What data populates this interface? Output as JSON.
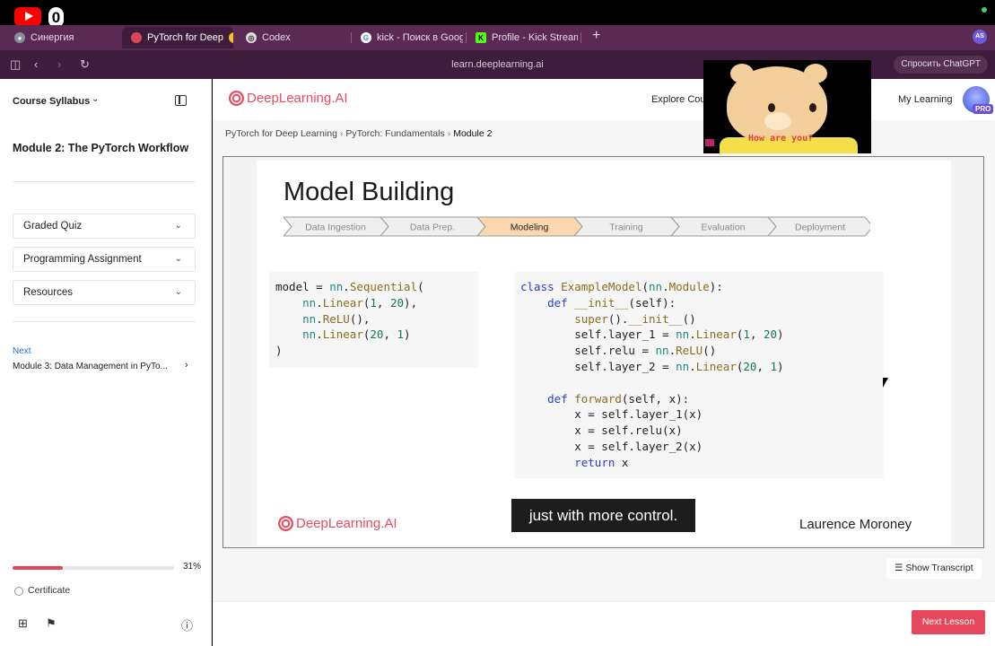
{
  "browser": {
    "tabs": [
      {
        "label": "Синергия",
        "favicon": "synergy-icon"
      },
      {
        "label": "PyTorch for Deep",
        "favicon": "deeplearning-icon"
      },
      {
        "label": "Codex",
        "favicon": "openai-icon"
      },
      {
        "label": "kick - Поиск в Google",
        "favicon": "google-icon"
      },
      {
        "label": "Profile - Kick Stream",
        "favicon": "kick-icon"
      }
    ],
    "url": "learn.deeplearning.ai",
    "ask_chatgpt": "Спросить ChatGPT",
    "profile_initials": "AS",
    "youtube_count": "0"
  },
  "sidebar": {
    "syllabus_label": "Course Syllabus",
    "module_title": "Module 2: The PyTorch Workflow",
    "accordions": [
      "Graded Quiz",
      "Programming Assignment",
      "Resources"
    ],
    "next_label": "Next",
    "next_module": "Module 3: Data Management in PyTo...",
    "progress_percent": 31,
    "progress_label": "31%",
    "certificate": "Certificate"
  },
  "header": {
    "brand": "DeepLearning.AI",
    "explore": "Explore Cou",
    "my_learning": "My Learning",
    "pro_badge": "PRO"
  },
  "breadcrumbs": [
    "PyTorch for Deep Learning",
    "PyTorch: Fundamentals",
    "Module 2"
  ],
  "slide": {
    "title": "Model Building",
    "steps": [
      "Data Ingestion",
      "Data Prep.",
      "Modeling",
      "Training",
      "Evaluation",
      "Deployment"
    ],
    "active_step": 2,
    "code_left": [
      "model = nn.Sequential(",
      "    nn.Linear(1, 20),",
      "    nn.ReLU(),",
      "    nn.Linear(20, 1)",
      ")"
    ],
    "code_right": [
      "class ExampleModel(nn.Module):",
      "    def __init__(self):",
      "        super().__init__()",
      "        self.layer_1 = nn.Linear(1, 20)",
      "        self.relu = nn.ReLU()",
      "        self.layer_2 = nn.Linear(20, 1)",
      "",
      "    def forward(self, x):",
      "        x = self.layer_1(x)",
      "        x = self.relu(x)",
      "        x = self.layer_2(x)",
      "        return x"
    ],
    "caption": "just with more control.",
    "brand": "DeepLearning.AI",
    "presenter": "Laurence Moroney"
  },
  "overlay": {
    "text": "How are you?"
  },
  "actions": {
    "show_transcript": "Show Transcript",
    "next_lesson": "Next Lesson"
  },
  "colors": {
    "accent": "#e6475d",
    "active_step": "#fcd8b0",
    "tab_bar": "#5a2a55"
  }
}
